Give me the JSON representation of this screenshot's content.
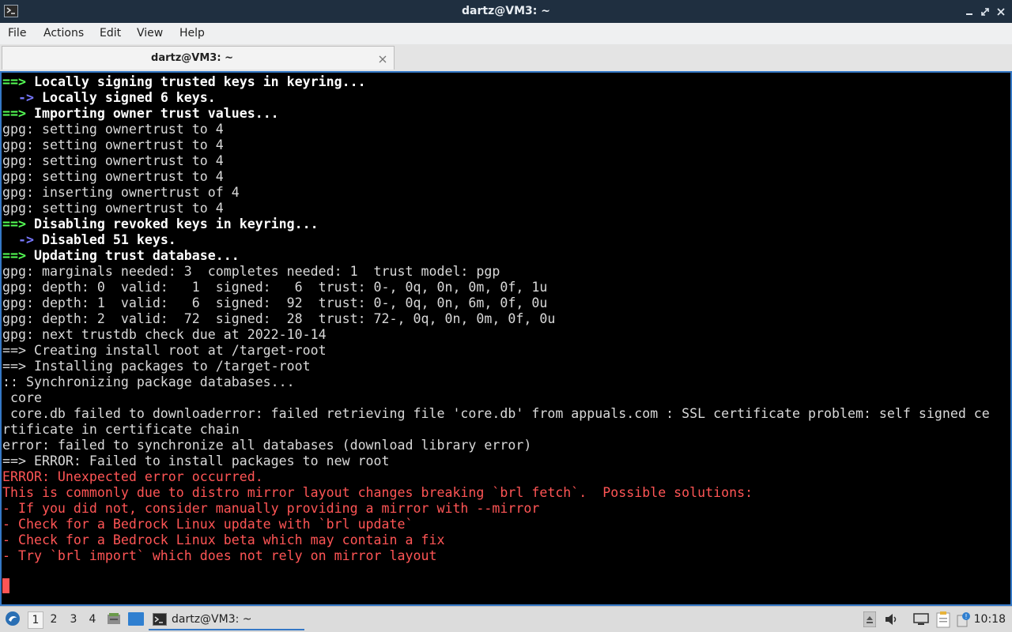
{
  "window": {
    "title": "dartz@VM3: ~"
  },
  "menu": [
    "File",
    "Actions",
    "Edit",
    "View",
    "Help"
  ],
  "tab": {
    "label": "dartz@VM3: ~"
  },
  "terminal": {
    "lines": [
      {
        "prefix": "==>",
        "prefix_style": "green",
        "text": " Locally signing trusted keys in keyring...",
        "style": "bold"
      },
      {
        "prefix": "  ->",
        "prefix_style": "blue",
        "text": " Locally signed 6 keys.",
        "style": "bold"
      },
      {
        "prefix": "==>",
        "prefix_style": "green",
        "text": " Importing owner trust values...",
        "style": "bold"
      },
      {
        "prefix": "",
        "text": "gpg: setting ownertrust to 4",
        "style": "white"
      },
      {
        "prefix": "",
        "text": "gpg: setting ownertrust to 4",
        "style": "white"
      },
      {
        "prefix": "",
        "text": "gpg: setting ownertrust to 4",
        "style": "white"
      },
      {
        "prefix": "",
        "text": "gpg: setting ownertrust to 4",
        "style": "white"
      },
      {
        "prefix": "",
        "text": "gpg: inserting ownertrust of 4",
        "style": "white"
      },
      {
        "prefix": "",
        "text": "gpg: setting ownertrust to 4",
        "style": "white"
      },
      {
        "prefix": "==>",
        "prefix_style": "green",
        "text": " Disabling revoked keys in keyring...",
        "style": "bold"
      },
      {
        "prefix": "  ->",
        "prefix_style": "blue",
        "text": " Disabled 51 keys.",
        "style": "bold"
      },
      {
        "prefix": "==>",
        "prefix_style": "green",
        "text": " Updating trust database...",
        "style": "bold"
      },
      {
        "prefix": "",
        "text": "gpg: marginals needed: 3  completes needed: 1  trust model: pgp",
        "style": "white"
      },
      {
        "prefix": "",
        "text": "gpg: depth: 0  valid:   1  signed:   6  trust: 0-, 0q, 0n, 0m, 0f, 1u",
        "style": "white"
      },
      {
        "prefix": "",
        "text": "gpg: depth: 1  valid:   6  signed:  92  trust: 0-, 0q, 0n, 6m, 0f, 0u",
        "style": "white"
      },
      {
        "prefix": "",
        "text": "gpg: depth: 2  valid:  72  signed:  28  trust: 72-, 0q, 0n, 0m, 0f, 0u",
        "style": "white"
      },
      {
        "prefix": "",
        "text": "gpg: next trustdb check due at 2022-10-14",
        "style": "white"
      },
      {
        "prefix": "",
        "text": "==> Creating install root at /target-root",
        "style": "white"
      },
      {
        "prefix": "",
        "text": "==> Installing packages to /target-root",
        "style": "white"
      },
      {
        "prefix": "",
        "text": ":: Synchronizing package databases...",
        "style": "white"
      },
      {
        "prefix": "",
        "text": " core",
        "style": "white"
      },
      {
        "prefix": "",
        "text": " core.db failed to downloaderror: failed retrieving file 'core.db' from appuals.com : SSL certificate problem: self signed ce",
        "style": "white"
      },
      {
        "prefix": "",
        "text": "rtificate in certificate chain",
        "style": "white"
      },
      {
        "prefix": "",
        "text": "error: failed to synchronize all databases (download library error)",
        "style": "white"
      },
      {
        "prefix": "",
        "text": "==> ERROR: Failed to install packages to new root",
        "style": "white"
      },
      {
        "prefix": "",
        "text": "ERROR: Unexpected error occurred.",
        "style": "red"
      },
      {
        "prefix": "",
        "text": "This is commonly due to distro mirror layout changes breaking `brl fetch`.  Possible solutions:",
        "style": "red"
      },
      {
        "prefix": "",
        "text": "- If you did not, consider manually providing a mirror with --mirror",
        "style": "red"
      },
      {
        "prefix": "",
        "text": "- Check for a Bedrock Linux update with `brl update`",
        "style": "red"
      },
      {
        "prefix": "",
        "text": "- Check for a Bedrock Linux beta which may contain a fix",
        "style": "red"
      },
      {
        "prefix": "",
        "text": "- Try `brl import` which does not rely on mirror layout",
        "style": "red"
      }
    ]
  },
  "taskbar": {
    "workspaces": [
      "1",
      "2",
      "3",
      "4"
    ],
    "active_workspace": "1",
    "task_label": "dartz@VM3: ~",
    "clock": "10:18"
  },
  "colors": {
    "accent": "#3478c6",
    "titlebar": "#1f2f40",
    "term_green": "#55ff55",
    "term_blue": "#7878ff",
    "term_red": "#ff5555"
  }
}
